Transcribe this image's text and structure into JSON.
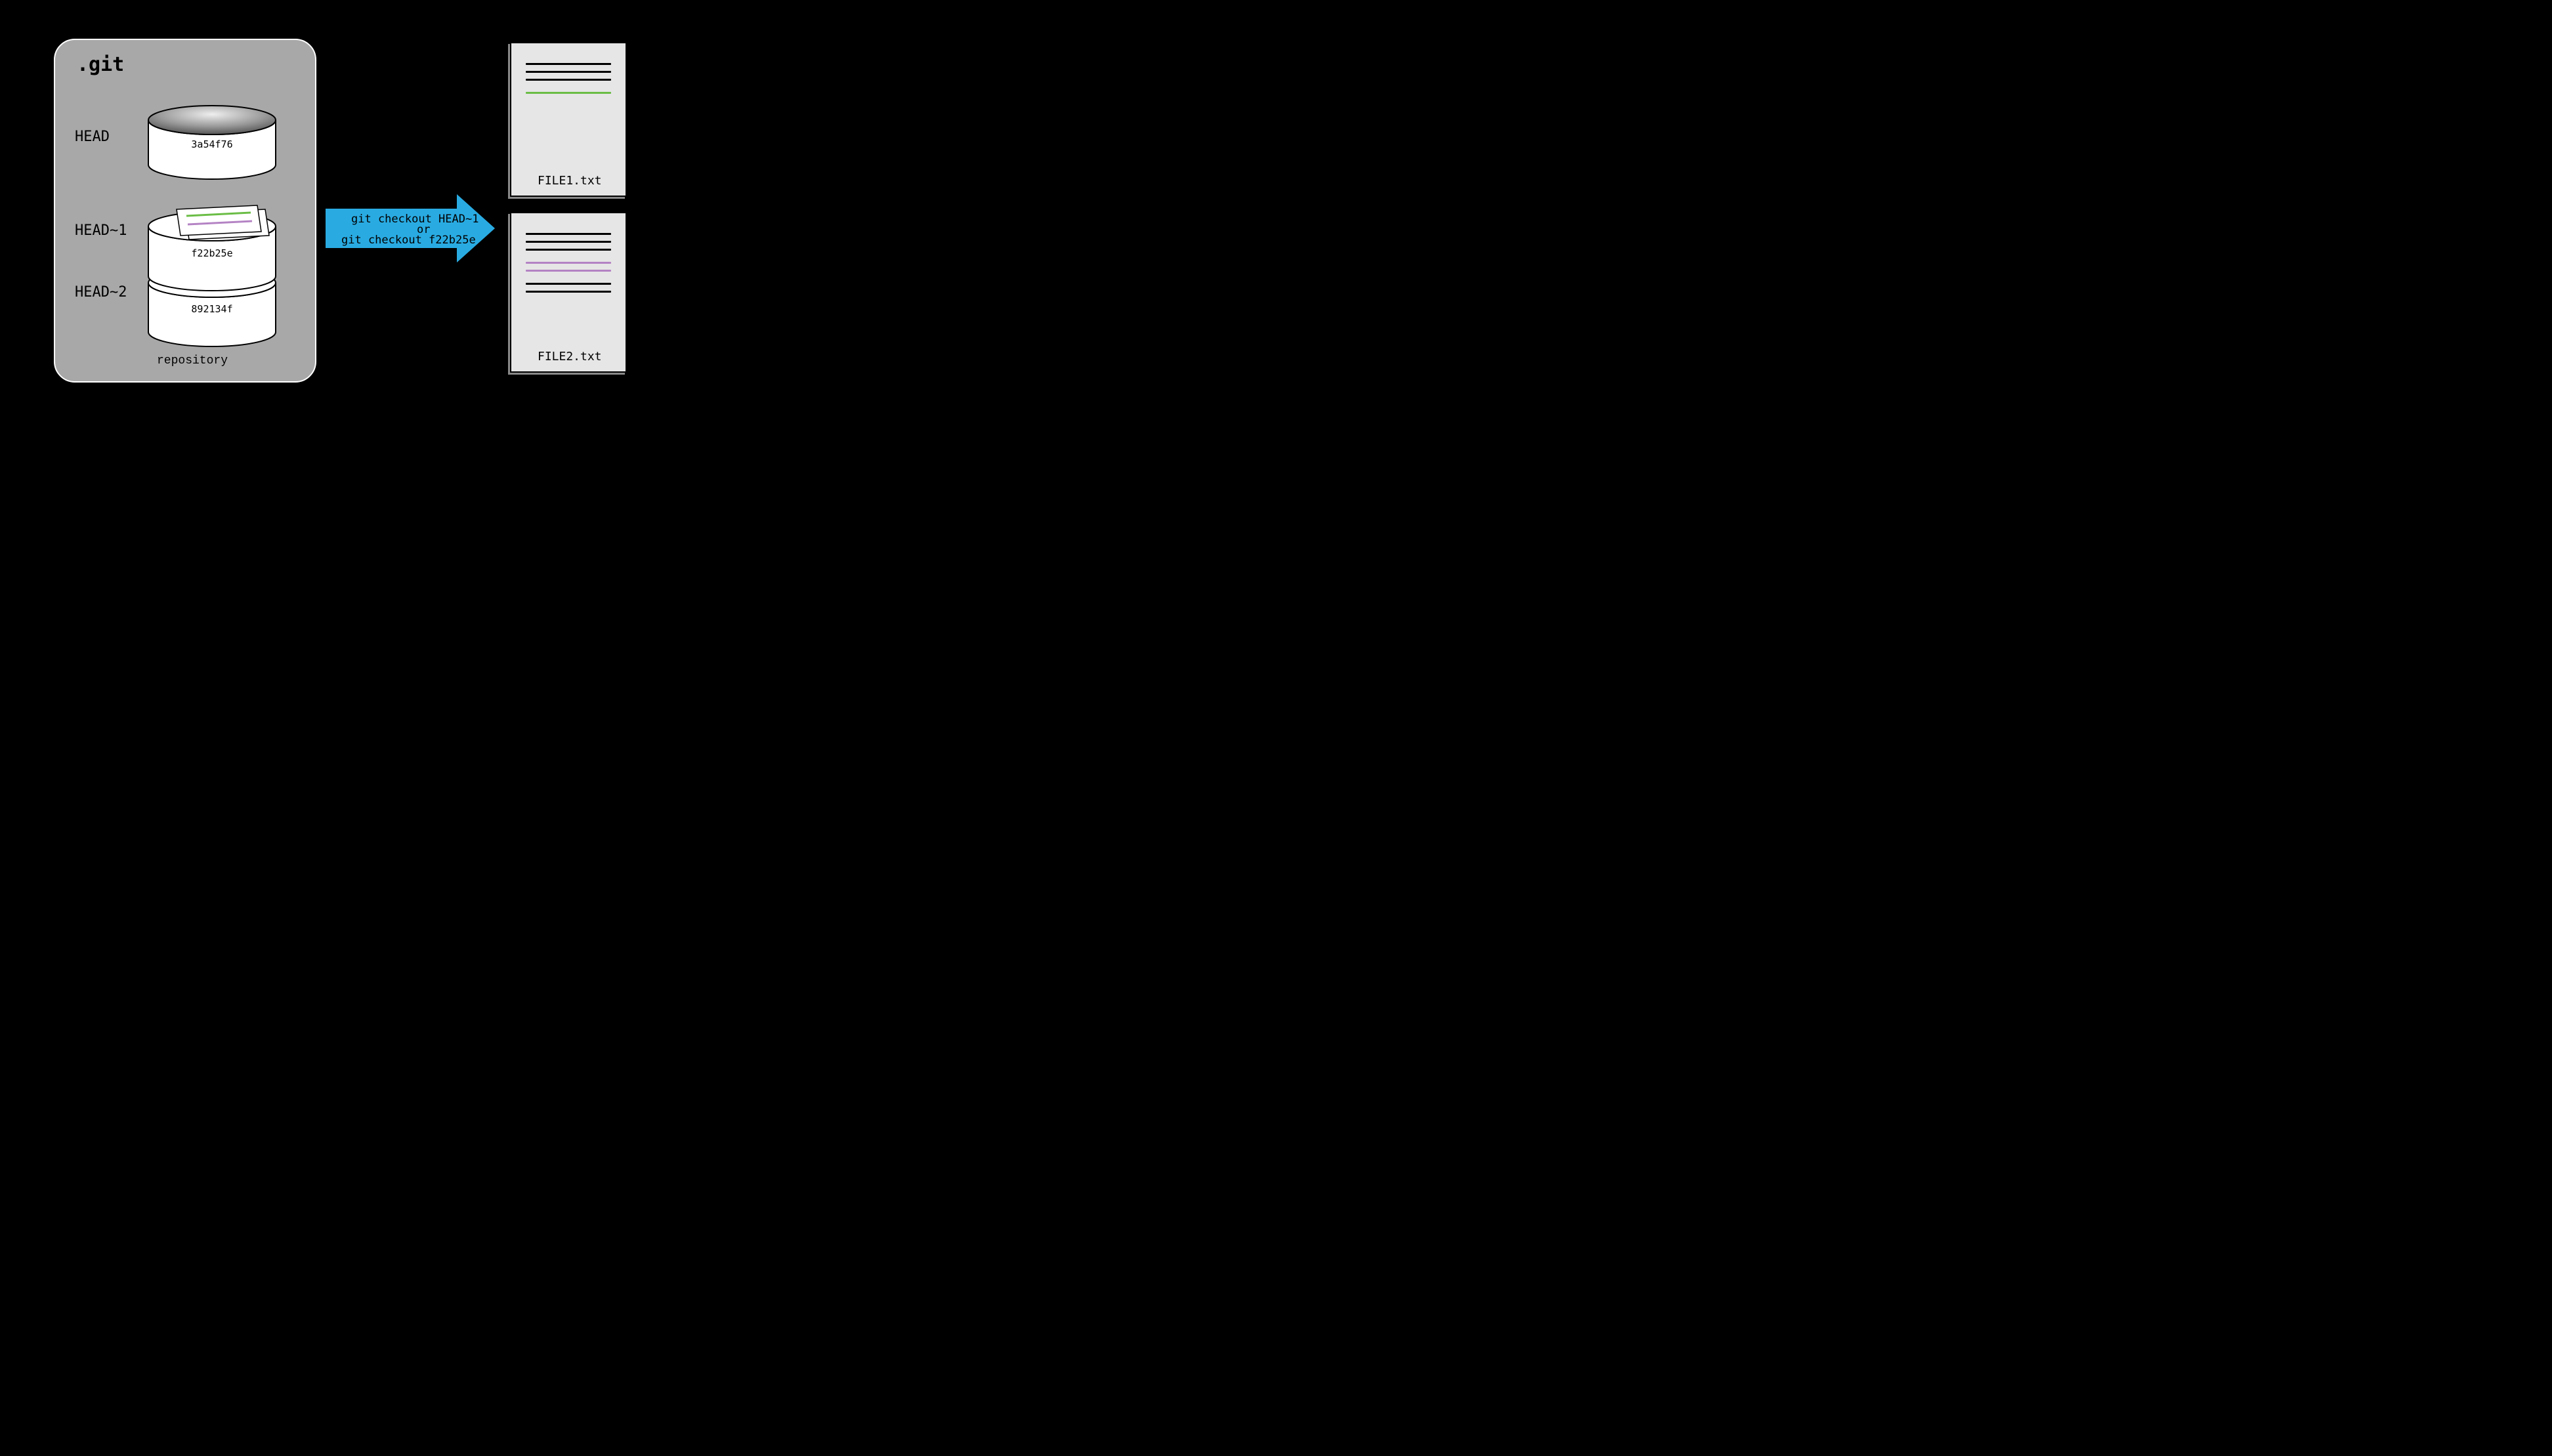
{
  "repo": {
    "git_label": ".git",
    "repository_label": "repository",
    "heads": {
      "head": "HEAD",
      "head1": "HEAD~1",
      "head2": "HEAD~2"
    },
    "commits": {
      "top": "3a54f76",
      "middle": "f22b25e",
      "bottom": "892134f"
    }
  },
  "arrow": {
    "line1": "git checkout HEAD~1",
    "or": "or",
    "line2": "git checkout f22b25e"
  },
  "files": {
    "file1": "FILE1.txt",
    "file2": "FILE2.txt"
  },
  "colors": {
    "green": "#6abd45",
    "violet": "#b483c4",
    "black": "#000000"
  }
}
